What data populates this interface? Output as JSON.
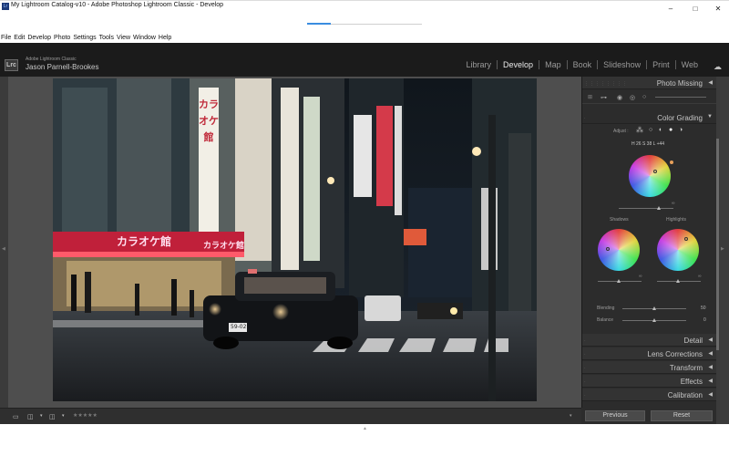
{
  "window": {
    "title": "My Lightroom Catalog-v10 - Adobe Photoshop Lightroom Classic - Develop",
    "minimize": "–",
    "maximize": "□",
    "close": "✕"
  },
  "menu": [
    "File",
    "Edit",
    "Develop",
    "Photo",
    "Settings",
    "Tools",
    "View",
    "Window",
    "Help"
  ],
  "identity": {
    "badge": "Lrc",
    "brand": "Adobe Lightroom Classic",
    "owner": "Jason Parnell-Brookes"
  },
  "modules": [
    {
      "label": "Library",
      "active": false
    },
    {
      "label": "Develop",
      "active": true
    },
    {
      "label": "Map",
      "active": false
    },
    {
      "label": "Book",
      "active": false
    },
    {
      "label": "Slideshow",
      "active": false
    },
    {
      "label": "Print",
      "active": false
    },
    {
      "label": "Web",
      "active": false
    }
  ],
  "photo_signs": {
    "karaoke_vertical": "カラオケ館",
    "karaoke_sign": "カラオケ館",
    "karaoke_sign_2": "カラオケ館",
    "plate": "59-02"
  },
  "panel": {
    "photo_missing": "Photo Missing",
    "color_grading": "Color Grading",
    "adjust_label": "Adjust :",
    "hsl_readout": "H 26 S 38 L +44",
    "shadows_label": "Shadows",
    "highlights_label": "Highlights",
    "blending_label": "Blending",
    "blending_value": "50",
    "balance_label": "Balance",
    "balance_value": "0",
    "sections": [
      "Detail",
      "Lens Corrections",
      "Transform",
      "Effects",
      "Calibration"
    ]
  },
  "buttons": {
    "previous": "Previous",
    "reset": "Reset"
  },
  "toolbar": {
    "stars": "★★★★★"
  },
  "colors": {
    "bg_workspace": "#4e4e4e",
    "panel": "#2c2c2c",
    "header": "#1b1b1b",
    "accent_load": "#3a8de0"
  }
}
